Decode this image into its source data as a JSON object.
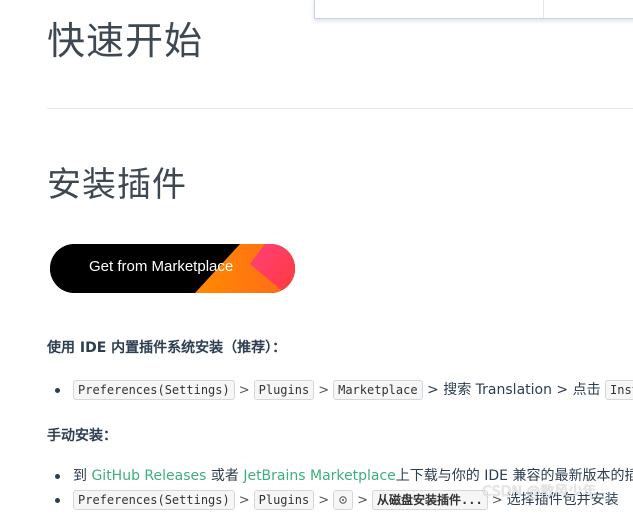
{
  "page": {
    "title": "快速开始",
    "section_title": "安装插件"
  },
  "marketplace_button": {
    "label": "Get from Marketplace",
    "colors": {
      "base": "#000000",
      "orange": "#ff7a18",
      "pink": "#ff2d6e",
      "red": "#ff3b3b"
    }
  },
  "install_recommended": {
    "heading": "使用 IDE 内置插件系统安装（推荐）：",
    "steps": [
      {
        "type": "code",
        "text": "Preferences(Settings)"
      },
      {
        "type": "sep",
        "text": ">"
      },
      {
        "type": "code",
        "text": "Plugins"
      },
      {
        "type": "sep",
        "text": ">"
      },
      {
        "type": "code",
        "text": "Marketplace"
      },
      {
        "type": "text",
        "text": "> 搜索 Translation > 点击"
      },
      {
        "type": "code",
        "text": "Inst"
      }
    ]
  },
  "install_manual": {
    "heading": "手动安装：",
    "item1": {
      "prefix": "到",
      "link1": "GitHub Releases",
      "middle": "或者",
      "link2": "JetBrains Marketplace",
      "suffix": "上下载与你的 IDE 兼容的最新版本的插件"
    },
    "item2": {
      "code1": "Preferences(Settings)",
      "sep1": ">",
      "code2": "Plugins",
      "sep2": ">",
      "gear_icon": "gear-icon",
      "sep3": ">",
      "code3": "从磁盘安装插件...",
      "sep4": ">",
      "suffix": "选择插件包并安装"
    }
  },
  "watermark": "CSDN @散风少年",
  "colors": {
    "link": "#3eaf7c",
    "text": "#2c3e50"
  }
}
